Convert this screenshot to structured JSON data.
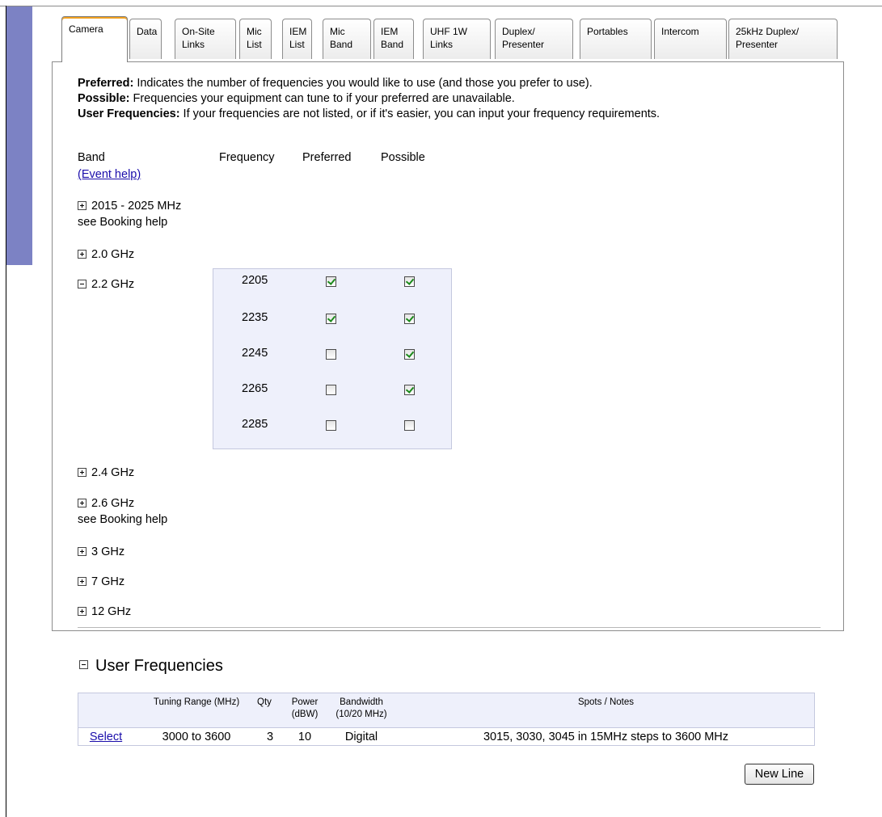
{
  "tabs": [
    {
      "label": "Camera"
    },
    {
      "label": "Data"
    },
    {
      "label": "On-Site\nLinks"
    },
    {
      "label": "Mic\nList"
    },
    {
      "label": "IEM\nList"
    },
    {
      "label": "Mic\nBand"
    },
    {
      "label": "IEM\nBand"
    },
    {
      "label": "UHF 1W\nLinks"
    },
    {
      "label": "Duplex/\nPresenter"
    },
    {
      "label": "Portables"
    },
    {
      "label": "Intercom"
    },
    {
      "label": "25kHz Duplex/\nPresenter"
    }
  ],
  "intro": {
    "preferred_term": "Preferred:",
    "preferred_text": " Indicates the number of frequencies you would like to use (and those you prefer to use).",
    "possible_term": "Possible:",
    "possible_text": " Frequencies your equipment can tune to if your preferred are unavailable.",
    "user_term": "User Frequencies:",
    "user_text": " If your frequencies are not listed, or if it's easier, you can input your frequency requirements."
  },
  "headers": {
    "band": "Band",
    "frequency": "Frequency",
    "preferred": "Preferred",
    "possible": "Possible",
    "event_help": "(Event help)"
  },
  "bands": [
    {
      "label": "2015 - 2025 MHz",
      "note": "see Booking help",
      "expanded": false
    },
    {
      "label": "2.0 GHz",
      "expanded": false
    },
    {
      "label": "2.2 GHz",
      "expanded": true
    },
    {
      "label": "2.4 GHz",
      "expanded": false
    },
    {
      "label": "2.6 GHz",
      "note": "see Booking help",
      "expanded": false
    },
    {
      "label": "3 GHz",
      "expanded": false
    },
    {
      "label": "7 GHz",
      "expanded": false
    },
    {
      "label": "12 GHz",
      "expanded": false
    }
  ],
  "frequencies_2_2": [
    {
      "freq": "2205",
      "preferred": true,
      "possible": true
    },
    {
      "freq": "2235",
      "preferred": true,
      "possible": true
    },
    {
      "freq": "2245",
      "preferred": false,
      "possible": true
    },
    {
      "freq": "2265",
      "preferred": false,
      "possible": true
    },
    {
      "freq": "2285",
      "preferred": false,
      "possible": false
    }
  ],
  "user_frequencies": {
    "title": "User Frequencies",
    "columns": {
      "tuning": "Tuning Range (MHz)",
      "qty": "Qty",
      "power": "Power\n(dBW)",
      "bandwidth": "Bandwidth\n(10/20 MHz)",
      "notes": "Spots / Notes"
    },
    "row": {
      "select": "Select",
      "tuning": "3000 to 3600",
      "qty": "3",
      "power": "10",
      "bandwidth": "Digital",
      "notes": "3015, 3030, 3045 in 15MHz steps to 3600 MHz"
    },
    "new_line": "New Line"
  }
}
